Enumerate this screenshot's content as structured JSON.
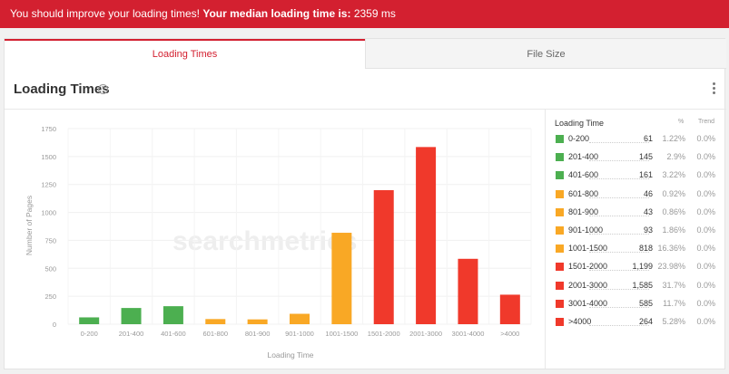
{
  "alert": {
    "prefix": "You should improve your loading times! ",
    "bold": "Your median loading time is:",
    "value": " 2359 ms"
  },
  "tabs": [
    {
      "label": "Loading Times",
      "active": true
    },
    {
      "label": "File Size",
      "active": false
    }
  ],
  "panel": {
    "title": "Loading Times",
    "help_icon": "question-circle-icon",
    "menu_icon": "kebab-menu-icon"
  },
  "watermark": "searchmetrics",
  "colors": {
    "green": "#4caf50",
    "orange": "#f9a825",
    "red": "#f0392b"
  },
  "chart_data": {
    "type": "bar",
    "categories": [
      "0-200",
      "201-400",
      "401-600",
      "601-800",
      "801-900",
      "901-1000",
      "1001-1500",
      "1501-2000",
      "2001-3000",
      "3001-4000",
      ">4000"
    ],
    "values": [
      61,
      145,
      161,
      46,
      43,
      93,
      818,
      1199,
      1585,
      585,
      264
    ],
    "bar_colors": [
      "green",
      "green",
      "green",
      "orange",
      "orange",
      "orange",
      "orange",
      "red",
      "red",
      "red",
      "red"
    ],
    "xlabel": "Loading Time",
    "ylabel": "Number of Pages",
    "ylim": [
      0,
      1750
    ],
    "yticks": [
      0,
      250,
      500,
      750,
      1000,
      1250,
      1500,
      1750
    ],
    "grid": true
  },
  "legend": {
    "headers": {
      "label": "Loading Time",
      "pct": "%",
      "trend": "Trend"
    },
    "rows": [
      {
        "label": "0-200",
        "count": "61",
        "pct": "1.22%",
        "trend": "0.0%",
        "color": "green"
      },
      {
        "label": "201-400",
        "count": "145",
        "pct": "2.9%",
        "trend": "0.0%",
        "color": "green"
      },
      {
        "label": "401-600",
        "count": "161",
        "pct": "3.22%",
        "trend": "0.0%",
        "color": "green"
      },
      {
        "label": "601-800",
        "count": "46",
        "pct": "0.92%",
        "trend": "0.0%",
        "color": "orange"
      },
      {
        "label": "801-900",
        "count": "43",
        "pct": "0.86%",
        "trend": "0.0%",
        "color": "orange"
      },
      {
        "label": "901-1000",
        "count": "93",
        "pct": "1.86%",
        "trend": "0.0%",
        "color": "orange"
      },
      {
        "label": "1001-1500",
        "count": "818",
        "pct": "16.36%",
        "trend": "0.0%",
        "color": "orange"
      },
      {
        "label": "1501-2000",
        "count": "1,199",
        "pct": "23.98%",
        "trend": "0.0%",
        "color": "red"
      },
      {
        "label": "2001-3000",
        "count": "1,585",
        "pct": "31.7%",
        "trend": "0.0%",
        "color": "red"
      },
      {
        "label": "3001-4000",
        "count": "585",
        "pct": "11.7%",
        "trend": "0.0%",
        "color": "red"
      },
      {
        "label": ">4000",
        "count": "264",
        "pct": "5.28%",
        "trend": "0.0%",
        "color": "red"
      }
    ]
  }
}
